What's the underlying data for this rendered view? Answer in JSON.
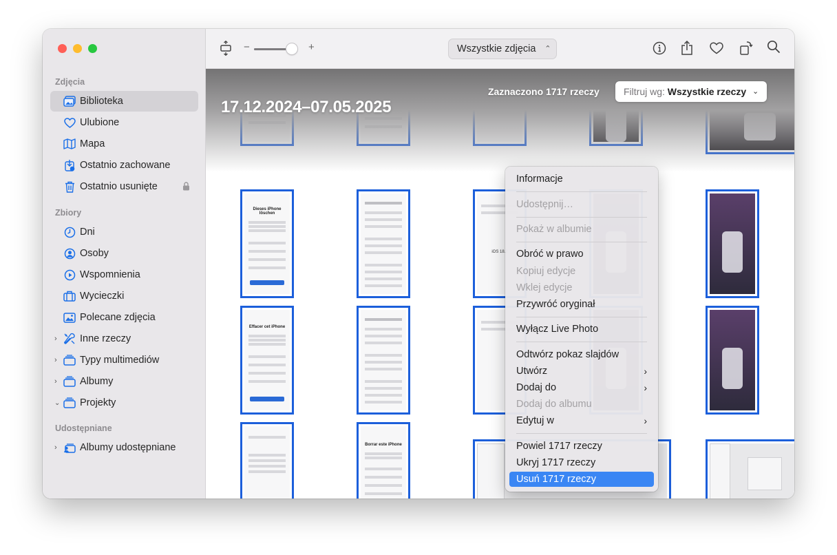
{
  "sidebar": {
    "sections": [
      {
        "title": "Zdjęcia"
      },
      {
        "title": "Zbiory"
      },
      {
        "title": "Udostępniane"
      }
    ],
    "items": [
      {
        "label": "Biblioteka"
      },
      {
        "label": "Ulubione"
      },
      {
        "label": "Mapa"
      },
      {
        "label": "Ostatnio zachowane"
      },
      {
        "label": "Ostatnio usunięte"
      },
      {
        "label": "Dni"
      },
      {
        "label": "Osoby"
      },
      {
        "label": "Wspomnienia"
      },
      {
        "label": "Wycieczki"
      },
      {
        "label": "Polecane zdjęcia"
      },
      {
        "label": "Inne rzeczy"
      },
      {
        "label": "Typy multimediów"
      },
      {
        "label": "Albumy"
      },
      {
        "label": "Projekty"
      },
      {
        "label": "Albumy udostępniane"
      }
    ]
  },
  "toolbar": {
    "zoom_minus": "−",
    "zoom_plus": "+",
    "zoom_level": 0.85,
    "view_select": "Wszystkie zdjęcia"
  },
  "content": {
    "date_range": "17.12.2024–07.05.2025",
    "selected_count": "Zaznaczono 1717 rzeczy",
    "filter_label": "Filtruj wg:",
    "filter_value": "Wszystkie rzeczy"
  },
  "thumbs": {
    "t1": [
      "Dieses iPhone löschen"
    ],
    "t2": [
      "Effacer cet iPhone"
    ],
    "t3": [
      "Borrar este iPhone"
    ],
    "t4": [
      "iOS 18.2"
    ]
  },
  "context_menu": {
    "items": [
      {
        "label": "Informacje"
      },
      {
        "label": "Udostępnij…"
      },
      {
        "label": "Pokaż w albumie"
      },
      {
        "label": "Obróć w prawo"
      },
      {
        "label": "Kopiuj edycje"
      },
      {
        "label": "Wklej edycje"
      },
      {
        "label": "Przywróć oryginał"
      },
      {
        "label": "Wyłącz Live Photo"
      },
      {
        "label": "Odtwórz pokaz slajdów"
      },
      {
        "label": "Utwórz"
      },
      {
        "label": "Dodaj do"
      },
      {
        "label": "Dodaj do albumu"
      },
      {
        "label": "Edytuj w"
      },
      {
        "label": "Powiel 1717 rzeczy"
      },
      {
        "label": "Ukryj 1717 rzeczy"
      },
      {
        "label": "Usuń 1717 rzeczy"
      }
    ]
  },
  "colors": {
    "selection_border": "#1c5fdb",
    "menu_highlight": "#3a86f4",
    "traffic_red": "#ff5f57",
    "traffic_yellow": "#febc2e",
    "traffic_green": "#28c840"
  }
}
